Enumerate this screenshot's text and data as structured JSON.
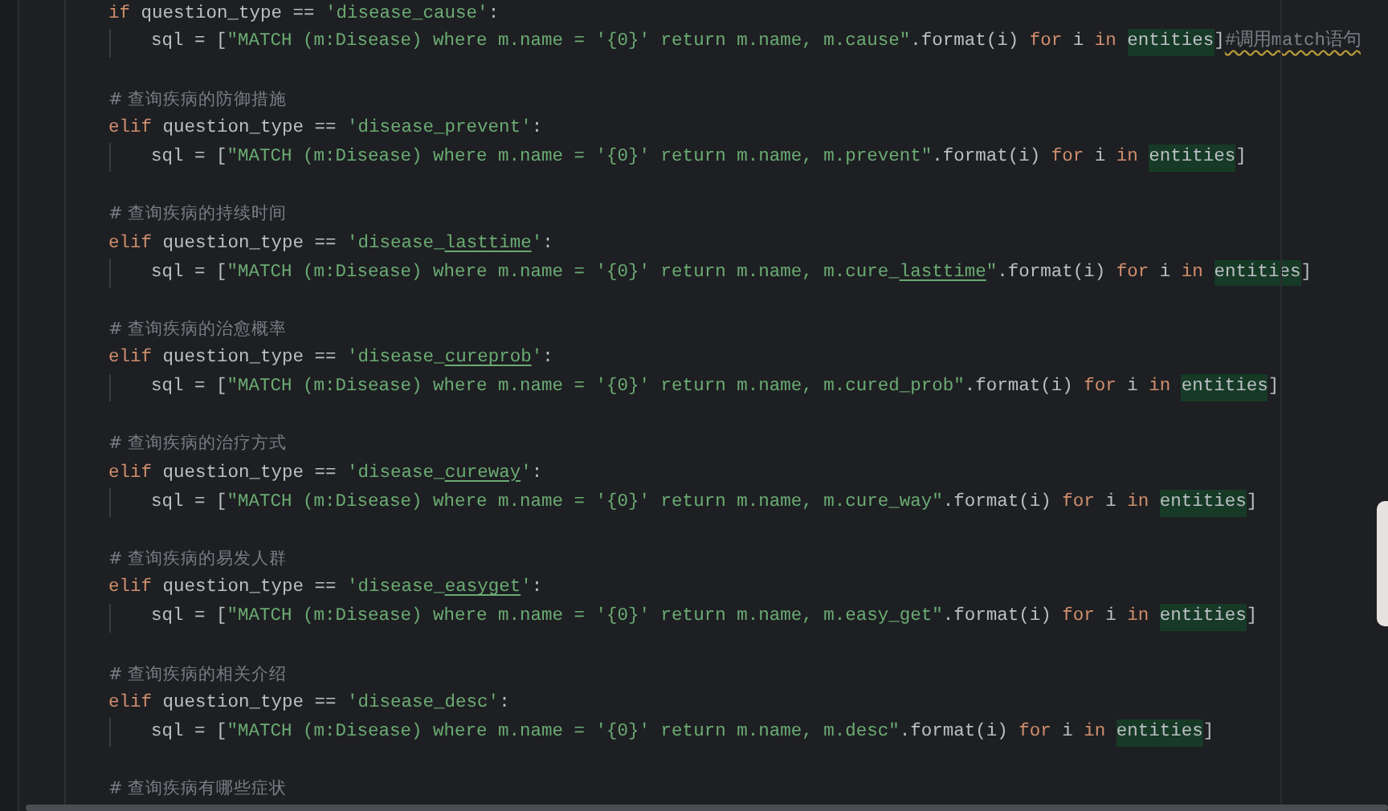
{
  "code_lines": [
    {
      "kind": "code",
      "tokens": [
        {
          "kind": "kw",
          "text": "if"
        },
        {
          "kind": "plain",
          "text": " question_type == "
        },
        {
          "kind": "str",
          "text": "'disease_cause'"
        },
        {
          "kind": "plain",
          "text": ":"
        }
      ],
      "children": [
        {
          "kind": "code",
          "tokens": [
            {
              "kind": "plain",
              "text": "sql = ["
            },
            {
              "kind": "str",
              "text": "\"MATCH (m:Disease) where m.name = '{0}' return m.name, m.cause\""
            },
            {
              "kind": "plain",
              "text": ".format(i) "
            },
            {
              "kind": "kw",
              "text": "for"
            },
            {
              "kind": "plain",
              "text": " i "
            },
            {
              "kind": "kw",
              "text": "in "
            },
            {
              "kind": "match",
              "text": "entities"
            },
            {
              "kind": "plain",
              "text": "]"
            },
            {
              "kind": "warn",
              "text": "#调用match语句"
            }
          ]
        }
      ]
    },
    {
      "kind": "blank"
    },
    {
      "kind": "code",
      "tokens": [
        {
          "kind": "comment",
          "text": "# 查询疾病的防御措施"
        }
      ]
    },
    {
      "kind": "code",
      "tokens": [
        {
          "kind": "kw",
          "text": "elif"
        },
        {
          "kind": "plain",
          "text": " question_type == "
        },
        {
          "kind": "str",
          "text": "'disease_prevent'"
        },
        {
          "kind": "plain",
          "text": ":"
        }
      ],
      "children": [
        {
          "kind": "code",
          "tokens": [
            {
              "kind": "plain",
              "text": "sql = ["
            },
            {
              "kind": "str",
              "text": "\"MATCH (m:Disease) where m.name = '{0}' return m.name, m.prevent\""
            },
            {
              "kind": "plain",
              "text": ".format(i) "
            },
            {
              "kind": "kw",
              "text": "for"
            },
            {
              "kind": "plain",
              "text": " i "
            },
            {
              "kind": "kw",
              "text": "in "
            },
            {
              "kind": "match",
              "text": "entities"
            },
            {
              "kind": "plain",
              "text": "]"
            }
          ]
        }
      ]
    },
    {
      "kind": "blank"
    },
    {
      "kind": "code",
      "tokens": [
        {
          "kind": "comment",
          "text": "# 查询疾病的持续时间"
        }
      ]
    },
    {
      "kind": "code",
      "tokens": [
        {
          "kind": "kw",
          "text": "elif"
        },
        {
          "kind": "plain",
          "text": " question_type == "
        },
        {
          "kind": "str",
          "text": "'disease_"
        },
        {
          "kind": "typo",
          "text": "lasttime"
        },
        {
          "kind": "str",
          "text": "'"
        },
        {
          "kind": "plain",
          "text": ":"
        }
      ],
      "children": [
        {
          "kind": "code",
          "tokens": [
            {
              "kind": "plain",
              "text": "sql = ["
            },
            {
              "kind": "str",
              "text": "\"MATCH (m:Disease) where m.name = '{0}' return m.name, m.cure_"
            },
            {
              "kind": "typo",
              "text": "lasttime"
            },
            {
              "kind": "str",
              "text": "\""
            },
            {
              "kind": "plain",
              "text": ".format(i) "
            },
            {
              "kind": "kw",
              "text": "for"
            },
            {
              "kind": "plain",
              "text": " i "
            },
            {
              "kind": "kw",
              "text": "in "
            },
            {
              "kind": "match",
              "text": "entities"
            },
            {
              "kind": "plain",
              "text": "]"
            }
          ]
        }
      ]
    },
    {
      "kind": "blank"
    },
    {
      "kind": "code",
      "tokens": [
        {
          "kind": "comment",
          "text": "# 查询疾病的治愈概率"
        }
      ]
    },
    {
      "kind": "code",
      "tokens": [
        {
          "kind": "kw",
          "text": "elif"
        },
        {
          "kind": "plain",
          "text": " question_type == "
        },
        {
          "kind": "str",
          "text": "'disease_"
        },
        {
          "kind": "typo",
          "text": "cureprob"
        },
        {
          "kind": "str",
          "text": "'"
        },
        {
          "kind": "plain",
          "text": ":"
        }
      ],
      "children": [
        {
          "kind": "code",
          "tokens": [
            {
              "kind": "plain",
              "text": "sql = ["
            },
            {
              "kind": "str",
              "text": "\"MATCH (m:Disease) where m.name = '{0}' return m.name, m.cured_prob\""
            },
            {
              "kind": "plain",
              "text": ".format(i) "
            },
            {
              "kind": "kw",
              "text": "for"
            },
            {
              "kind": "plain",
              "text": " i "
            },
            {
              "kind": "kw",
              "text": "in "
            },
            {
              "kind": "match",
              "text": "entities"
            },
            {
              "kind": "plain",
              "text": "]"
            }
          ]
        }
      ]
    },
    {
      "kind": "blank"
    },
    {
      "kind": "code",
      "tokens": [
        {
          "kind": "comment",
          "text": "# 查询疾病的治疗方式"
        }
      ]
    },
    {
      "kind": "code",
      "tokens": [
        {
          "kind": "kw",
          "text": "elif"
        },
        {
          "kind": "plain",
          "text": " question_type == "
        },
        {
          "kind": "str",
          "text": "'disease_"
        },
        {
          "kind": "typo",
          "text": "cureway"
        },
        {
          "kind": "str",
          "text": "'"
        },
        {
          "kind": "plain",
          "text": ":"
        }
      ],
      "children": [
        {
          "kind": "code",
          "tokens": [
            {
              "kind": "plain",
              "text": "sql = ["
            },
            {
              "kind": "str",
              "text": "\"MATCH (m:Disease) where m.name = '{0}' return m.name, m.cure_way\""
            },
            {
              "kind": "plain",
              "text": ".format(i) "
            },
            {
              "kind": "kw",
              "text": "for"
            },
            {
              "kind": "plain",
              "text": " i "
            },
            {
              "kind": "kw",
              "text": "in "
            },
            {
              "kind": "match",
              "text": "entities"
            },
            {
              "kind": "plain",
              "text": "]"
            }
          ]
        }
      ]
    },
    {
      "kind": "blank"
    },
    {
      "kind": "code",
      "tokens": [
        {
          "kind": "comment",
          "text": "# 查询疾病的易发人群"
        }
      ]
    },
    {
      "kind": "code",
      "tokens": [
        {
          "kind": "kw",
          "text": "elif"
        },
        {
          "kind": "plain",
          "text": " question_type == "
        },
        {
          "kind": "str",
          "text": "'disease_"
        },
        {
          "kind": "typo",
          "text": "easyget"
        },
        {
          "kind": "str",
          "text": "'"
        },
        {
          "kind": "plain",
          "text": ":"
        }
      ],
      "children": [
        {
          "kind": "code",
          "tokens": [
            {
              "kind": "plain",
              "text": "sql = ["
            },
            {
              "kind": "str",
              "text": "\"MATCH (m:Disease) where m.name = '{0}' return m.name, m.easy_get\""
            },
            {
              "kind": "plain",
              "text": ".format(i) "
            },
            {
              "kind": "kw",
              "text": "for"
            },
            {
              "kind": "plain",
              "text": " i "
            },
            {
              "kind": "kw",
              "text": "in "
            },
            {
              "kind": "match",
              "text": "entities"
            },
            {
              "kind": "plain",
              "text": "]"
            }
          ]
        }
      ]
    },
    {
      "kind": "blank"
    },
    {
      "kind": "code",
      "tokens": [
        {
          "kind": "comment",
          "text": "# 查询疾病的相关介绍"
        }
      ]
    },
    {
      "kind": "code",
      "tokens": [
        {
          "kind": "kw",
          "text": "elif"
        },
        {
          "kind": "plain",
          "text": " question_type == "
        },
        {
          "kind": "str",
          "text": "'disease_desc'"
        },
        {
          "kind": "plain",
          "text": ":"
        }
      ],
      "children": [
        {
          "kind": "code",
          "tokens": [
            {
              "kind": "plain",
              "text": "sql = ["
            },
            {
              "kind": "str",
              "text": "\"MATCH (m:Disease) where m.name = '{0}' return m.name, m.desc\""
            },
            {
              "kind": "plain",
              "text": ".format(i) "
            },
            {
              "kind": "kw",
              "text": "for"
            },
            {
              "kind": "plain",
              "text": " i "
            },
            {
              "kind": "kw",
              "text": "in "
            },
            {
              "kind": "match",
              "text": "entities"
            },
            {
              "kind": "plain",
              "text": "]"
            }
          ]
        }
      ]
    },
    {
      "kind": "blank"
    },
    {
      "kind": "code",
      "tokens": [
        {
          "kind": "comment",
          "text": "# 查询疾病有哪些症状"
        }
      ]
    }
  ]
}
